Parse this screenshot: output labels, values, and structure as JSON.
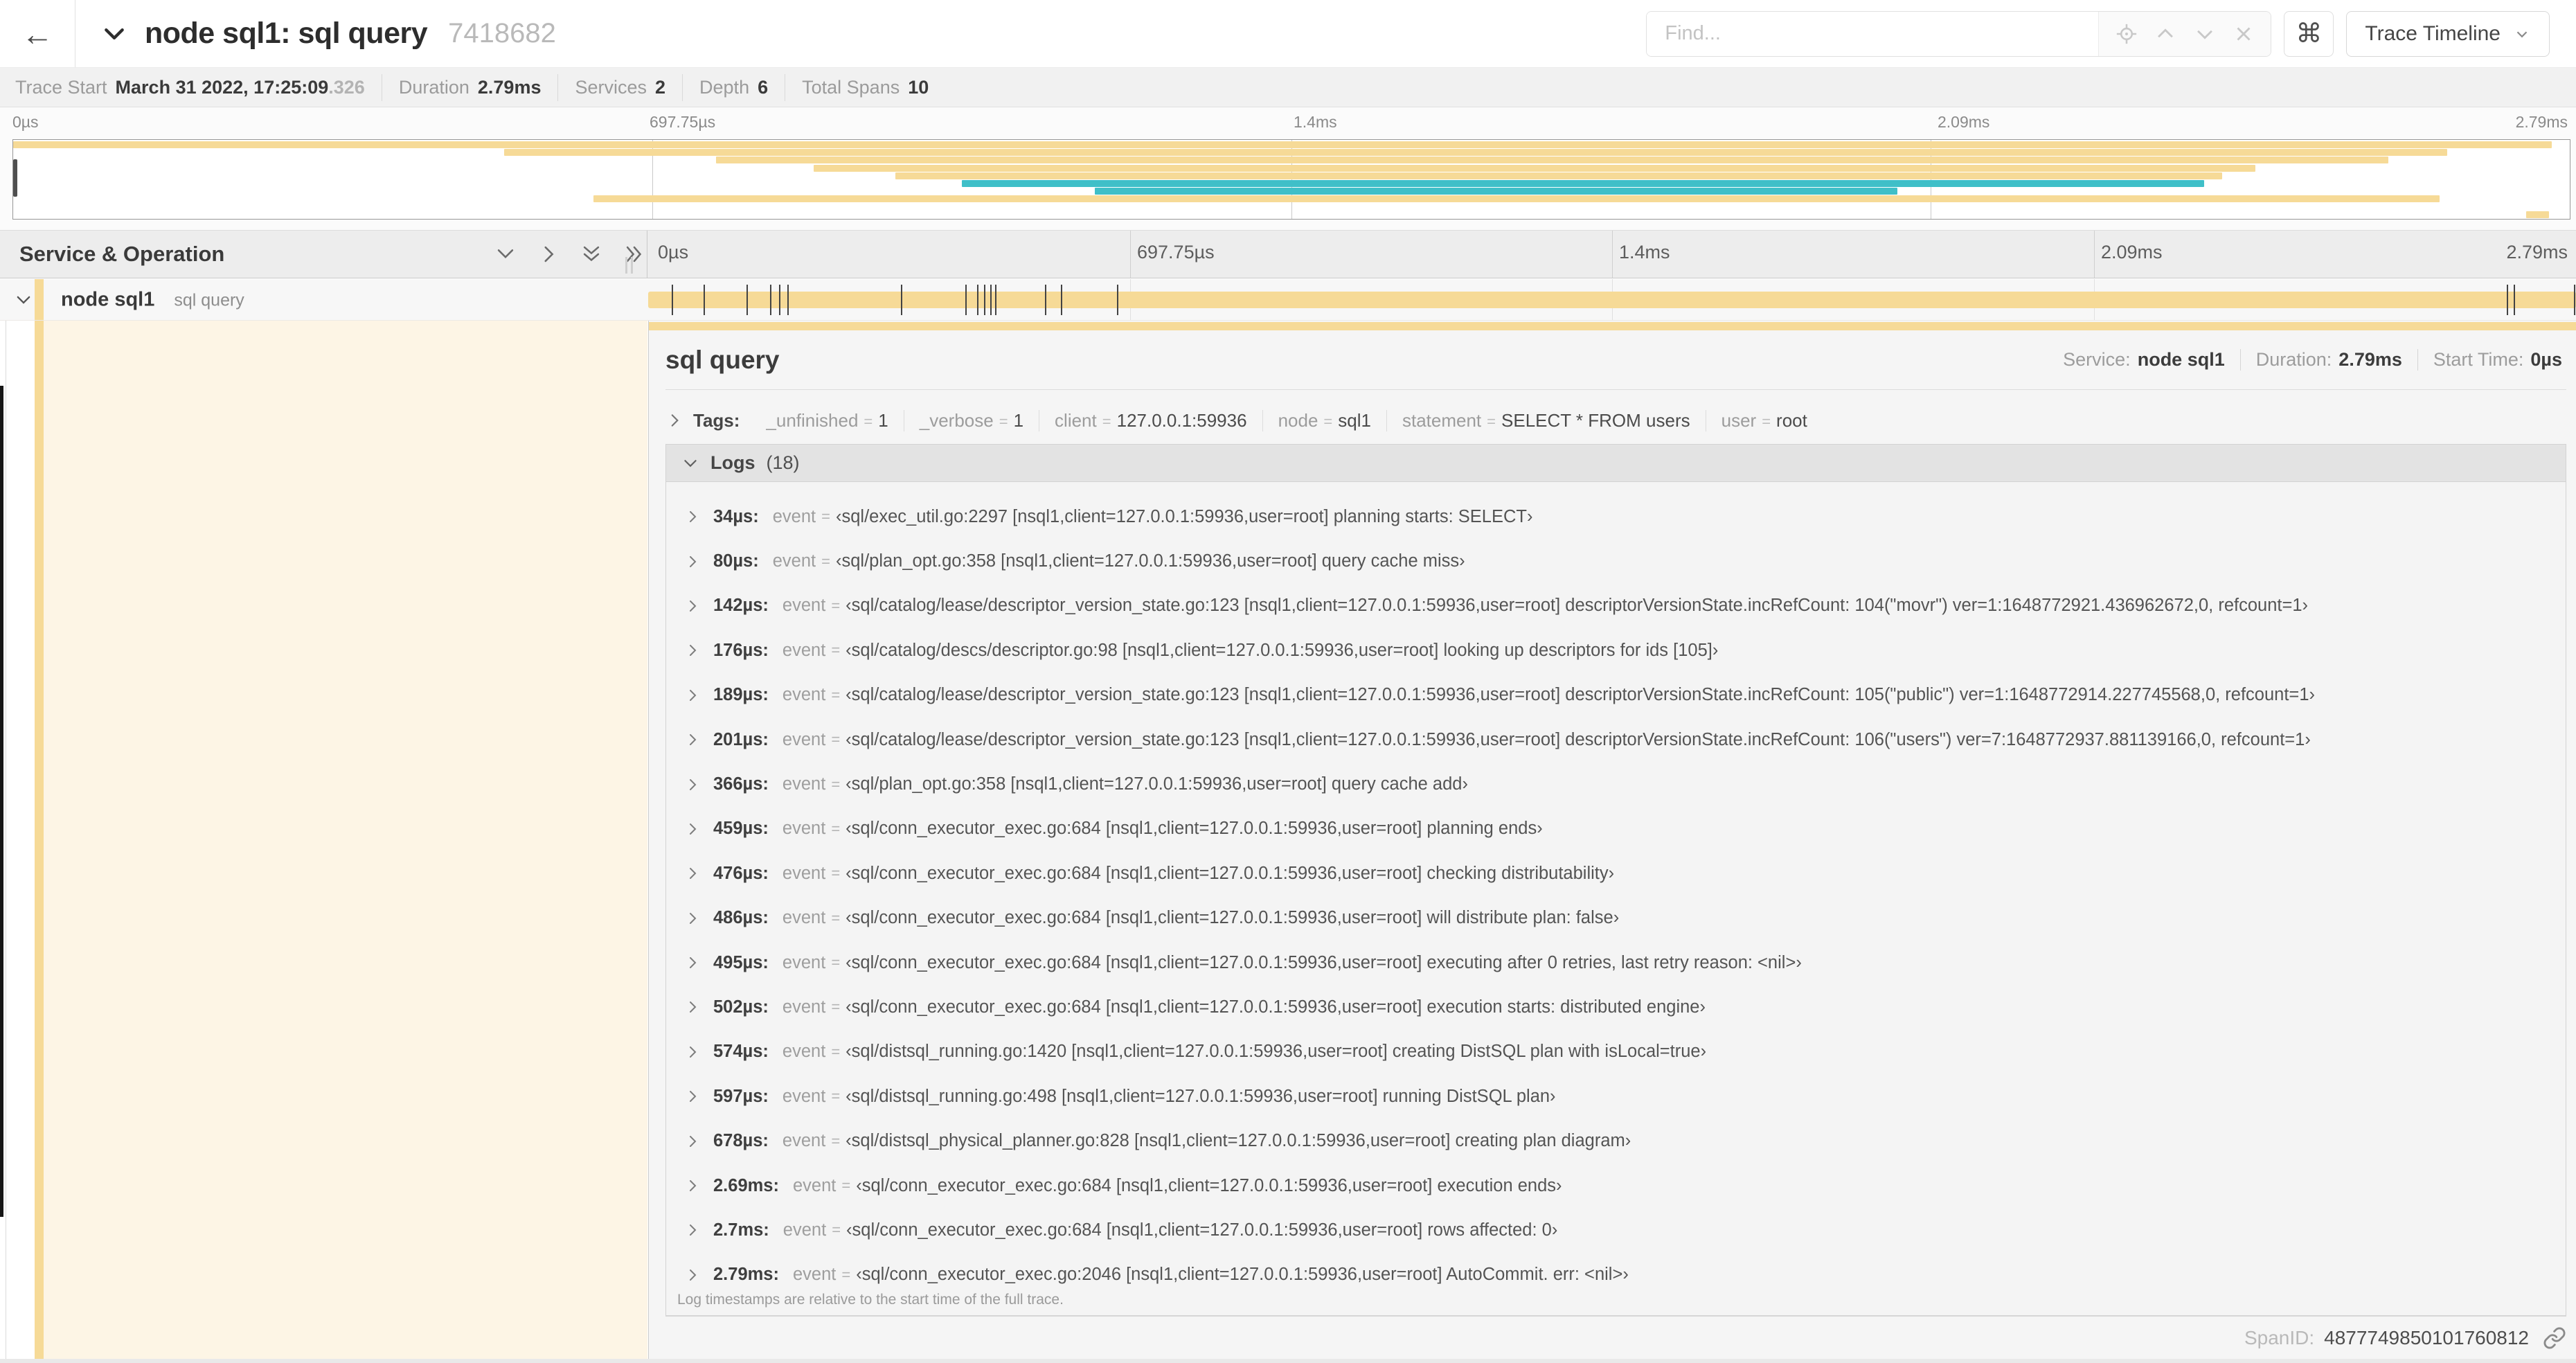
{
  "header": {
    "title": "node sql1: sql query",
    "trace_id_short": "7418682",
    "find_placeholder": "Find...",
    "command_glyph": "⌘",
    "view_selector_label": "Trace Timeline",
    "back_glyph": "←",
    "find_suffix_icons": [
      "locate-icon",
      "chevron-up-icon",
      "chevron-down-icon",
      "clear-icon"
    ]
  },
  "trace_info": {
    "items": [
      {
        "label": "Trace Start",
        "value": "March 31 2022, 17:25:09",
        "suffix": ".326"
      },
      {
        "label": "Duration",
        "value": "2.79ms"
      },
      {
        "label": "Services",
        "value": "2"
      },
      {
        "label": "Depth",
        "value": "6"
      },
      {
        "label": "Total Spans",
        "value": "10"
      }
    ]
  },
  "minimap": {
    "tick_labels": [
      "0µs",
      "697.75µs",
      "1.4ms",
      "2.09ms",
      "2.79ms"
    ],
    "colors": {
      "tan": "#F6DA97",
      "teal": "#3FBFC8"
    },
    "spans": [
      {
        "row": 0,
        "start": 0,
        "end": 99.3,
        "color": "tan"
      },
      {
        "row": 1,
        "start": 19.2,
        "end": 95.2,
        "color": "tan"
      },
      {
        "row": 2,
        "start": 27.5,
        "end": 92.9,
        "color": "tan"
      },
      {
        "row": 3,
        "start": 31.3,
        "end": 87.7,
        "color": "tan"
      },
      {
        "row": 4,
        "start": 34.5,
        "end": 86.4,
        "color": "tan"
      },
      {
        "row": 5,
        "start": 37.1,
        "end": 85.7,
        "color": "teal"
      },
      {
        "row": 6,
        "start": 42.3,
        "end": 73.7,
        "color": "teal"
      },
      {
        "row": 7,
        "start": 22.7,
        "end": 94.9,
        "color": "tan"
      },
      {
        "row": 9,
        "start": 98.3,
        "end": 99.2,
        "color": "tan"
      }
    ]
  },
  "timeline_header": {
    "left_title": "Service & Operation",
    "ruler_labels": [
      "0µs",
      "697.75µs",
      "1.4ms",
      "2.09ms",
      "2.79ms"
    ]
  },
  "span_row": {
    "service": "node sql1",
    "operation": "sql query",
    "bar_color": "#F6DA97",
    "total_duration_us": 2790
  },
  "detail": {
    "title": "sql query",
    "overview": [
      {
        "label": "Service:",
        "value": "node sql1"
      },
      {
        "label": "Duration:",
        "value": "2.79ms"
      },
      {
        "label": "Start Time:",
        "value": "0µs"
      }
    ],
    "tags": {
      "label": "Tags:",
      "items": [
        {
          "key": "_unfinished",
          "value": "1"
        },
        {
          "key": "_verbose",
          "value": "1"
        },
        {
          "key": "client",
          "value": "127.0.0.1:59936"
        },
        {
          "key": "node",
          "value": "sql1"
        },
        {
          "key": "statement",
          "value": "SELECT * FROM users"
        },
        {
          "key": "user",
          "value": "root"
        }
      ]
    },
    "logs": {
      "label": "Logs",
      "count": "(18)",
      "rows": [
        {
          "t_us": 34,
          "time": "34µs:",
          "key": "event",
          "value": "‹sql/exec_util.go:2297 [nsql1,client=127.0.0.1:59936,user=root] planning starts: SELECT›"
        },
        {
          "t_us": 80,
          "time": "80µs:",
          "key": "event",
          "value": "‹sql/plan_opt.go:358 [nsql1,client=127.0.0.1:59936,user=root] query cache miss›"
        },
        {
          "t_us": 142,
          "time": "142µs:",
          "key": "event",
          "value": "‹sql/catalog/lease/descriptor_version_state.go:123 [nsql1,client=127.0.0.1:59936,user=root] descriptorVersionState.incRefCount: 104(\"movr\") ver=1:1648772921.436962672,0, refcount=1›"
        },
        {
          "t_us": 176,
          "time": "176µs:",
          "key": "event",
          "value": "‹sql/catalog/descs/descriptor.go:98 [nsql1,client=127.0.0.1:59936,user=root] looking up descriptors for ids [105]›"
        },
        {
          "t_us": 189,
          "time": "189µs:",
          "key": "event",
          "value": "‹sql/catalog/lease/descriptor_version_state.go:123 [nsql1,client=127.0.0.1:59936,user=root] descriptorVersionState.incRefCount: 105(\"public\") ver=1:1648772914.227745568,0, refcount=1›"
        },
        {
          "t_us": 201,
          "time": "201µs:",
          "key": "event",
          "value": "‹sql/catalog/lease/descriptor_version_state.go:123 [nsql1,client=127.0.0.1:59936,user=root] descriptorVersionState.incRefCount: 106(\"users\") ver=7:1648772937.881139166,0, refcount=1›"
        },
        {
          "t_us": 366,
          "time": "366µs:",
          "key": "event",
          "value": "‹sql/plan_opt.go:358 [nsql1,client=127.0.0.1:59936,user=root] query cache add›"
        },
        {
          "t_us": 459,
          "time": "459µs:",
          "key": "event",
          "value": "‹sql/conn_executor_exec.go:684 [nsql1,client=127.0.0.1:59936,user=root] planning ends›"
        },
        {
          "t_us": 476,
          "time": "476µs:",
          "key": "event",
          "value": "‹sql/conn_executor_exec.go:684 [nsql1,client=127.0.0.1:59936,user=root] checking distributability›"
        },
        {
          "t_us": 486,
          "time": "486µs:",
          "key": "event",
          "value": "‹sql/conn_executor_exec.go:684 [nsql1,client=127.0.0.1:59936,user=root] will distribute plan: false›"
        },
        {
          "t_us": 495,
          "time": "495µs:",
          "key": "event",
          "value": "‹sql/conn_executor_exec.go:684 [nsql1,client=127.0.0.1:59936,user=root] executing after 0 retries, last retry reason: <nil>›"
        },
        {
          "t_us": 502,
          "time": "502µs:",
          "key": "event",
          "value": "‹sql/conn_executor_exec.go:684 [nsql1,client=127.0.0.1:59936,user=root] execution starts: distributed engine›"
        },
        {
          "t_us": 574,
          "time": "574µs:",
          "key": "event",
          "value": "‹sql/distsql_running.go:1420 [nsql1,client=127.0.0.1:59936,user=root] creating DistSQL plan with isLocal=true›"
        },
        {
          "t_us": 597,
          "time": "597µs:",
          "key": "event",
          "value": "‹sql/distsql_running.go:498 [nsql1,client=127.0.0.1:59936,user=root] running DistSQL plan›"
        },
        {
          "t_us": 678,
          "time": "678µs:",
          "key": "event",
          "value": "‹sql/distsql_physical_planner.go:828 [nsql1,client=127.0.0.1:59936,user=root] creating plan diagram›"
        },
        {
          "t_us": 2690,
          "time": "2.69ms:",
          "key": "event",
          "value": "‹sql/conn_executor_exec.go:684 [nsql1,client=127.0.0.1:59936,user=root] execution ends›"
        },
        {
          "t_us": 2700,
          "time": "2.7ms:",
          "key": "event",
          "value": "‹sql/conn_executor_exec.go:684 [nsql1,client=127.0.0.1:59936,user=root] rows affected: 0›"
        },
        {
          "t_us": 2790,
          "time": "2.79ms:",
          "key": "event",
          "value": "‹sql/conn_executor_exec.go:2046 [nsql1,client=127.0.0.1:59936,user=root] AutoCommit. err: <nil>›"
        }
      ],
      "footer": "Log timestamps are relative to the start time of the full trace."
    },
    "span_id": {
      "label": "SpanID:",
      "value": "4877749850101760812"
    }
  }
}
